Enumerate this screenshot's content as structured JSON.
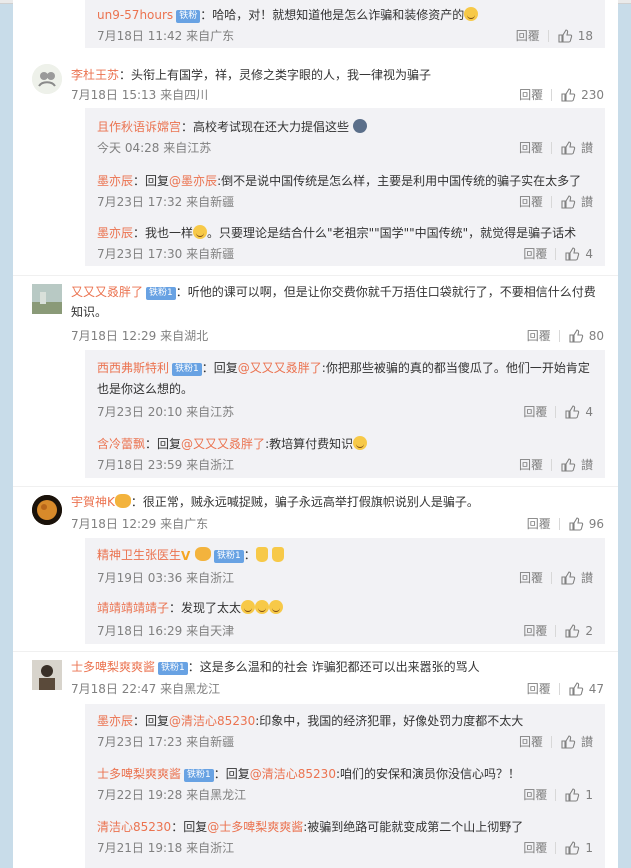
{
  "comments": [
    {
      "id": "c0",
      "user": "un9-57hours",
      "text": "哈哈，对！就想知道他是怎么诈骗和装修资产的",
      "time": "7月18日 11:42 来自广东",
      "reply_label": "回覆",
      "likes": "18"
    },
    {
      "id": "c1",
      "user": "李杜王苏",
      "text": "头衔上有国学，祥，灵修之类字眼的人，我一律视为骗子",
      "time": "7月18日 15:13 来自四川",
      "reply_label": "回覆",
      "likes": "230",
      "replies": [
        {
          "user": "且作秋语诉嫦宫",
          "text": "高校考试现在还大力提倡这些",
          "time": "今天 04:28 来自江苏",
          "reply_label": "回覆",
          "likes": "讃"
        },
        {
          "user": "墨亦辰",
          "prefix": "回复",
          "mention": "@墨亦辰",
          "text": ":倒不是说中国传统是怎么样，主要是利用中国传统的骗子实在太多了",
          "time": "7月23日 17:32 来自新疆",
          "reply_label": "回覆",
          "likes": "讃"
        },
        {
          "user": "墨亦辰",
          "text": "我也一样",
          "text2": "。只要理论是结合什么\"老祖宗\"\"国学\"\"中国传统\"，就觉得是骗子话术",
          "time": "7月23日 17:30 来自新疆",
          "reply_label": "回覆",
          "likes": "4"
        }
      ]
    },
    {
      "id": "c2",
      "user": "又又又叒胖了",
      "badge": "铁粉1",
      "text": "听他的课可以啊，但是让你交费你就千万捂住口袋就行了，不要相信什么付费知识。",
      "time": "7月18日 12:29 来自湖北",
      "reply_label": "回覆",
      "likes": "80",
      "replies": [
        {
          "user": "西西弗斯特利",
          "badge": "铁粉1",
          "prefix": "回复",
          "mention": "@又又又叒胖了",
          "text": ":你把那些被骗的真的都当傻瓜了。他们一开始肯定也是你这么想的。",
          "time": "7月23日 20:10 来自江苏",
          "reply_label": "回覆",
          "likes": "4"
        },
        {
          "user": "含冷蕾飘",
          "prefix": "回复",
          "mention": "@又又又叒胖了",
          "text": ":教培算付费知识",
          "time": "7月18日 23:59 来自浙江",
          "reply_label": "回覆",
          "likes": "讃"
        }
      ]
    },
    {
      "id": "c3",
      "user": "宇賀神K",
      "text": "很正常，贼永远喊捉贼，骗子永远高举打假旗帜说别人是骗子。",
      "time": "7月18日 12:29 来自广东",
      "reply_label": "回覆",
      "likes": "96",
      "replies": [
        {
          "user": "精神卫生张医生",
          "badge": "铁粉1",
          "text": "",
          "time": "7月19日 03:36 来自浙江",
          "reply_label": "回覆",
          "likes": "讃"
        },
        {
          "user": "靖靖靖靖靖子",
          "text": "发现了太太",
          "time": "7月18日 16:29 来自天津",
          "reply_label": "回覆",
          "likes": "2"
        }
      ]
    },
    {
      "id": "c4",
      "user": "士多啤梨爽爽酱",
      "badge": "铁粉1",
      "text": "这是多么温和的社会 诈骗犯都还可以出来嚣张的骂人",
      "time": "7月18日 22:47 来自黑龙江",
      "reply_label": "回覆",
      "likes": "47",
      "replies": [
        {
          "user": "墨亦辰",
          "prefix": "回复",
          "mention": "@清洁心85230",
          "text": ":印象中，我国的经济犯罪，好像处罚力度都不太大",
          "time": "7月23日 17:23 来自新疆",
          "reply_label": "回覆",
          "likes": "讃"
        },
        {
          "user": "士多啤梨爽爽酱",
          "badge": "铁粉1",
          "prefix": "回复",
          "mention": "@清洁心85230",
          "text": ":咱们的安保和演员你没信心吗？！",
          "time": "7月22日 19:28 来自黑龙江",
          "reply_label": "回覆",
          "likes": "1"
        },
        {
          "user": "清洁心85230",
          "prefix": "回复",
          "mention": "@士多啤梨爽爽酱",
          "text": ":被骗到绝路可能就变成第二个山上彻野了",
          "time": "7月21日 19:18 来自浙江",
          "reply_label": "回覆",
          "likes": "1"
        }
      ]
    }
  ]
}
